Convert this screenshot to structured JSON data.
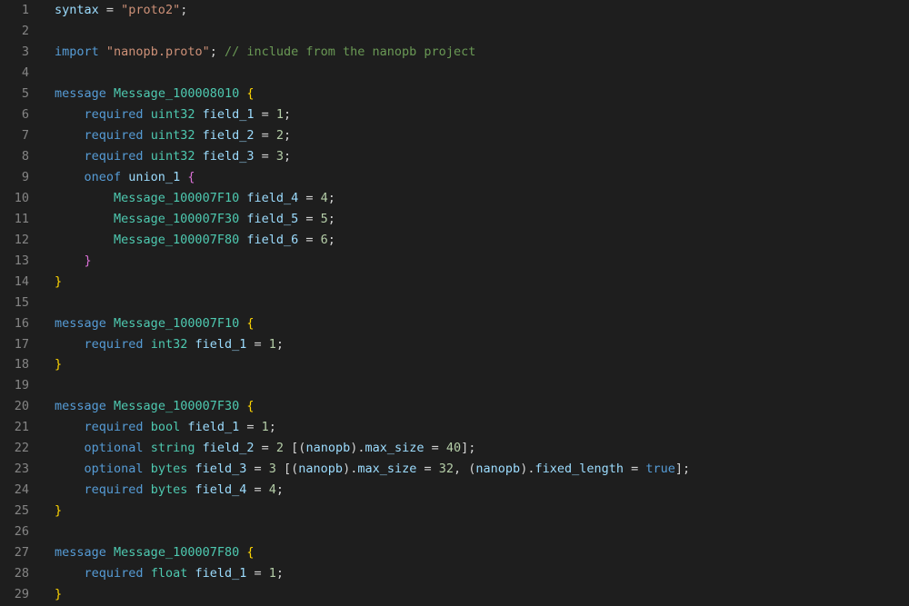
{
  "lineCount": 29,
  "code": {
    "l1": [
      [
        "tk-ident",
        "syntax"
      ],
      [
        "tk-punct",
        " = "
      ],
      [
        "tk-string",
        "\"proto2\""
      ],
      [
        "tk-punct",
        ";"
      ]
    ],
    "l2": [],
    "l3": [
      [
        "tk-keyword",
        "import"
      ],
      [
        "tk-punct",
        " "
      ],
      [
        "tk-string",
        "\"nanopb.proto\""
      ],
      [
        "tk-punct",
        "; "
      ],
      [
        "tk-comment",
        "// include from the nanopb project"
      ]
    ],
    "l4": [],
    "l5": [
      [
        "tk-keyword",
        "message"
      ],
      [
        "tk-punct",
        " "
      ],
      [
        "tk-type",
        "Message_100008010"
      ],
      [
        "tk-punct",
        " "
      ],
      [
        "tk-brace",
        "{"
      ]
    ],
    "l6": [
      [
        "",
        "    "
      ],
      [
        "tk-keyword",
        "required"
      ],
      [
        "tk-punct",
        " "
      ],
      [
        "tk-type",
        "uint32"
      ],
      [
        "tk-punct",
        " "
      ],
      [
        "tk-ident",
        "field_1"
      ],
      [
        "tk-punct",
        " = "
      ],
      [
        "tk-number",
        "1"
      ],
      [
        "tk-punct",
        ";"
      ]
    ],
    "l7": [
      [
        "",
        "    "
      ],
      [
        "tk-keyword",
        "required"
      ],
      [
        "tk-punct",
        " "
      ],
      [
        "tk-type",
        "uint32"
      ],
      [
        "tk-punct",
        " "
      ],
      [
        "tk-ident",
        "field_2"
      ],
      [
        "tk-punct",
        " = "
      ],
      [
        "tk-number",
        "2"
      ],
      [
        "tk-punct",
        ";"
      ]
    ],
    "l8": [
      [
        "",
        "    "
      ],
      [
        "tk-keyword",
        "required"
      ],
      [
        "tk-punct",
        " "
      ],
      [
        "tk-type",
        "uint32"
      ],
      [
        "tk-punct",
        " "
      ],
      [
        "tk-ident",
        "field_3"
      ],
      [
        "tk-punct",
        " = "
      ],
      [
        "tk-number",
        "3"
      ],
      [
        "tk-punct",
        ";"
      ]
    ],
    "l9": [
      [
        "",
        "    "
      ],
      [
        "tk-keyword",
        "oneof"
      ],
      [
        "tk-punct",
        " "
      ],
      [
        "tk-ident",
        "union_1"
      ],
      [
        "tk-punct",
        " "
      ],
      [
        "tk-brace2",
        "{"
      ]
    ],
    "l10": [
      [
        "",
        "        "
      ],
      [
        "tk-type",
        "Message_100007F10"
      ],
      [
        "tk-punct",
        " "
      ],
      [
        "tk-ident",
        "field_4"
      ],
      [
        "tk-punct",
        " = "
      ],
      [
        "tk-number",
        "4"
      ],
      [
        "tk-punct",
        ";"
      ]
    ],
    "l11": [
      [
        "",
        "        "
      ],
      [
        "tk-type",
        "Message_100007F30"
      ],
      [
        "tk-punct",
        " "
      ],
      [
        "tk-ident",
        "field_5"
      ],
      [
        "tk-punct",
        " = "
      ],
      [
        "tk-number",
        "5"
      ],
      [
        "tk-punct",
        ";"
      ]
    ],
    "l12": [
      [
        "",
        "        "
      ],
      [
        "tk-type",
        "Message_100007F80"
      ],
      [
        "tk-punct",
        " "
      ],
      [
        "tk-ident",
        "field_6"
      ],
      [
        "tk-punct",
        " = "
      ],
      [
        "tk-number",
        "6"
      ],
      [
        "tk-punct",
        ";"
      ]
    ],
    "l13": [
      [
        "",
        "    "
      ],
      [
        "tk-brace2",
        "}"
      ]
    ],
    "l14": [
      [
        "tk-brace",
        "}"
      ]
    ],
    "l15": [],
    "l16": [
      [
        "tk-keyword",
        "message"
      ],
      [
        "tk-punct",
        " "
      ],
      [
        "tk-type",
        "Message_100007F10"
      ],
      [
        "tk-punct",
        " "
      ],
      [
        "tk-brace",
        "{"
      ]
    ],
    "l17": [
      [
        "",
        "    "
      ],
      [
        "tk-keyword",
        "required"
      ],
      [
        "tk-punct",
        " "
      ],
      [
        "tk-type",
        "int32"
      ],
      [
        "tk-punct",
        " "
      ],
      [
        "tk-ident",
        "field_1"
      ],
      [
        "tk-punct",
        " = "
      ],
      [
        "tk-number",
        "1"
      ],
      [
        "tk-punct",
        ";"
      ]
    ],
    "l18": [
      [
        "tk-brace",
        "}"
      ]
    ],
    "l19": [],
    "l20": [
      [
        "tk-keyword",
        "message"
      ],
      [
        "tk-punct",
        " "
      ],
      [
        "tk-type",
        "Message_100007F30"
      ],
      [
        "tk-punct",
        " "
      ],
      [
        "tk-brace",
        "{"
      ]
    ],
    "l21": [
      [
        "",
        "    "
      ],
      [
        "tk-keyword",
        "required"
      ],
      [
        "tk-punct",
        " "
      ],
      [
        "tk-type",
        "bool"
      ],
      [
        "tk-punct",
        " "
      ],
      [
        "tk-ident",
        "field_1"
      ],
      [
        "tk-punct",
        " = "
      ],
      [
        "tk-number",
        "1"
      ],
      [
        "tk-punct",
        ";"
      ]
    ],
    "l22": [
      [
        "",
        "    "
      ],
      [
        "tk-keyword",
        "optional"
      ],
      [
        "tk-punct",
        " "
      ],
      [
        "tk-type",
        "string"
      ],
      [
        "tk-punct",
        " "
      ],
      [
        "tk-ident",
        "field_2"
      ],
      [
        "tk-punct",
        " = "
      ],
      [
        "tk-number",
        "2"
      ],
      [
        "tk-punct",
        " [("
      ],
      [
        "tk-ident",
        "nanopb"
      ],
      [
        "tk-punct",
        ")."
      ],
      [
        "tk-ident",
        "max_size"
      ],
      [
        "tk-punct",
        " = "
      ],
      [
        "tk-number",
        "40"
      ],
      [
        "tk-punct",
        "];"
      ]
    ],
    "l23": [
      [
        "",
        "    "
      ],
      [
        "tk-keyword",
        "optional"
      ],
      [
        "tk-punct",
        " "
      ],
      [
        "tk-type",
        "bytes"
      ],
      [
        "tk-punct",
        " "
      ],
      [
        "tk-ident",
        "field_3"
      ],
      [
        "tk-punct",
        " = "
      ],
      [
        "tk-number",
        "3"
      ],
      [
        "tk-punct",
        " [("
      ],
      [
        "tk-ident",
        "nanopb"
      ],
      [
        "tk-punct",
        ")."
      ],
      [
        "tk-ident",
        "max_size"
      ],
      [
        "tk-punct",
        " = "
      ],
      [
        "tk-number",
        "32"
      ],
      [
        "tk-punct",
        ", ("
      ],
      [
        "tk-ident",
        "nanopb"
      ],
      [
        "tk-punct",
        ")."
      ],
      [
        "tk-ident",
        "fixed_length"
      ],
      [
        "tk-punct",
        " = "
      ],
      [
        "tk-bool",
        "true"
      ],
      [
        "tk-punct",
        "];"
      ]
    ],
    "l24": [
      [
        "",
        "    "
      ],
      [
        "tk-keyword",
        "required"
      ],
      [
        "tk-punct",
        " "
      ],
      [
        "tk-type",
        "bytes"
      ],
      [
        "tk-punct",
        " "
      ],
      [
        "tk-ident",
        "field_4"
      ],
      [
        "tk-punct",
        " = "
      ],
      [
        "tk-number",
        "4"
      ],
      [
        "tk-punct",
        ";"
      ]
    ],
    "l25": [
      [
        "tk-brace",
        "}"
      ]
    ],
    "l26": [],
    "l27": [
      [
        "tk-keyword",
        "message"
      ],
      [
        "tk-punct",
        " "
      ],
      [
        "tk-type",
        "Message_100007F80"
      ],
      [
        "tk-punct",
        " "
      ],
      [
        "tk-brace",
        "{"
      ]
    ],
    "l28": [
      [
        "",
        "    "
      ],
      [
        "tk-keyword",
        "required"
      ],
      [
        "tk-punct",
        " "
      ],
      [
        "tk-type",
        "float"
      ],
      [
        "tk-punct",
        " "
      ],
      [
        "tk-ident",
        "field_1"
      ],
      [
        "tk-punct",
        " = "
      ],
      [
        "tk-number",
        "1"
      ],
      [
        "tk-punct",
        ";"
      ]
    ],
    "l29": [
      [
        "tk-brace",
        "}"
      ]
    ]
  }
}
